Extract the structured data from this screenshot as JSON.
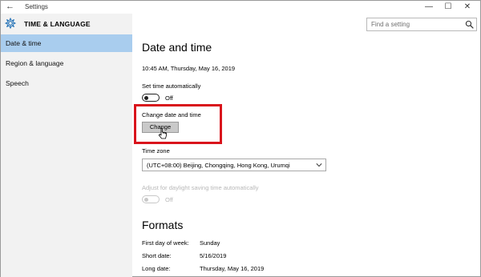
{
  "window": {
    "title": "Settings"
  },
  "titlebar": {
    "back_glyph": "←",
    "min_glyph": "—",
    "max_glyph": "☐",
    "close_glyph": "✕"
  },
  "sidebar": {
    "section_title": "TIME & LANGUAGE",
    "items": [
      {
        "label": "Date & time",
        "active": true
      },
      {
        "label": "Region & language",
        "active": false
      },
      {
        "label": "Speech",
        "active": false
      }
    ]
  },
  "search": {
    "placeholder": "Find a setting"
  },
  "date_time": {
    "heading": "Date and time",
    "current": "10:45 AM, Thursday, May 16, 2019",
    "set_auto": {
      "label": "Set time automatically",
      "state_text": "Off"
    },
    "change": {
      "label": "Change date and time",
      "button": "Change"
    },
    "time_zone": {
      "label": "Time zone",
      "value": "(UTC+08:00) Beijing, Chongqing, Hong Kong, Urumqi"
    },
    "dst": {
      "label": "Adjust for daylight saving time automatically",
      "state_text": "Off"
    }
  },
  "formats": {
    "heading": "Formats",
    "rows": [
      {
        "label": "First day of week:",
        "value": "Sunday"
      },
      {
        "label": "Short date:",
        "value": "5/16/2019"
      },
      {
        "label": "Long date:",
        "value": "Thursday, May 16, 2019"
      }
    ]
  },
  "colors": {
    "accent_highlight": "#d9141c",
    "sidebar_active": "#a9cdee",
    "sidebar_bg": "#f2f2f2"
  }
}
